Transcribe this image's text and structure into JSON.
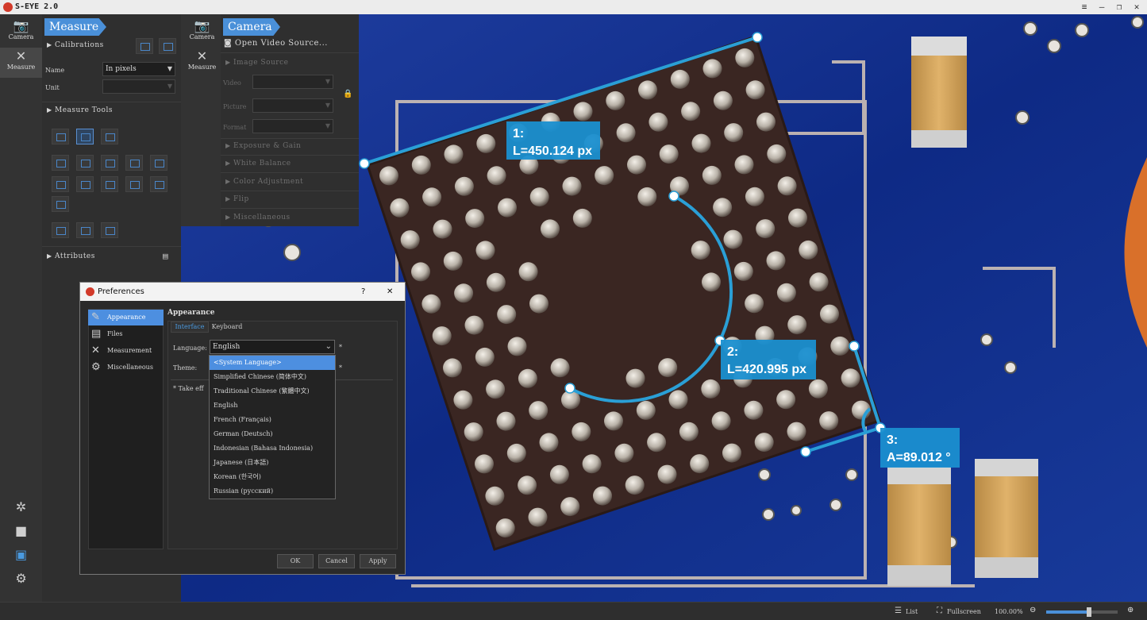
{
  "app": {
    "title": "S-EYE 2.0"
  },
  "window_controls": {
    "menu": "≡",
    "minimize": "–",
    "restore": "❐"
  },
  "rail_left": {
    "items": [
      {
        "label": "Camera",
        "icon": "camera-icon"
      },
      {
        "label": "Measure",
        "icon": "measure-tools-icon"
      }
    ]
  },
  "rail_bottom": {
    "icons": [
      "aperture-icon",
      "video-camera-icon",
      "image-gallery-icon",
      "settings-gear-icon"
    ]
  },
  "measure_panel": {
    "tab": "Measure",
    "calibrations": "Calibrations",
    "name_label": "Name",
    "name_value": "In pixels",
    "unit_label": "Unit",
    "unit_value": "",
    "measure_tools": "Measure Tools",
    "attributes": "Attributes"
  },
  "rail_mid": {
    "items": [
      {
        "label": "Camera",
        "icon": "camera-icon"
      },
      {
        "label": "Measure",
        "icon": "measure-tools-icon"
      }
    ]
  },
  "camera_panel": {
    "tab": "Camera",
    "open_source": "Open Video Source...",
    "image_source": "Image Source",
    "video_label": "Video",
    "picture_label": "Picture",
    "format_label": "Format",
    "sections": [
      "Exposure & Gain",
      "White Balance",
      "Color Adjustment",
      "Flip",
      "Miscellaneous"
    ]
  },
  "measurements": [
    {
      "index": "1:",
      "value": "L=450.124 px"
    },
    {
      "index": "2:",
      "value": "L=420.995 px"
    },
    {
      "index": "3:",
      "value": "A=89.012 °"
    }
  ],
  "preferences": {
    "title": "Preferences",
    "help": "?",
    "close": "✕",
    "nav": [
      "Appearance",
      "Files",
      "Measurement",
      "Miscellaneous"
    ],
    "nav_icons": [
      "appearance-icon",
      "files-icon",
      "measurement-icon",
      "miscellaneous-icon"
    ],
    "heading": "Appearance",
    "tabs": [
      "Interface",
      "Keyboard"
    ],
    "language_label": "Language:",
    "language_value": "English",
    "theme_label": "Theme:",
    "take_effect": "* Take eff",
    "asterisk": "*",
    "buttons": {
      "ok": "OK",
      "cancel": "Cancel",
      "apply": "Apply"
    },
    "language_options": [
      "<System Language>",
      "Simplified Chinese (简体中文)",
      "Traditional Chinese (繁體中文)",
      "English",
      "French (Français)",
      "German (Deutsch)",
      "Indonesian (Bahasa Indonesia)",
      "Japanese (日本語)",
      "Korean (한국어)",
      "Russian (русский)"
    ],
    "highlighted_option": 0
  },
  "statusbar": {
    "list": "List",
    "fullscreen": "Fullscreen",
    "zoom": "100.00%",
    "zoom_level": 0.6
  },
  "colors": {
    "accent": "#4a90d9",
    "overlay": "#2a9fd6",
    "label_bg": "#1a8fd0"
  }
}
